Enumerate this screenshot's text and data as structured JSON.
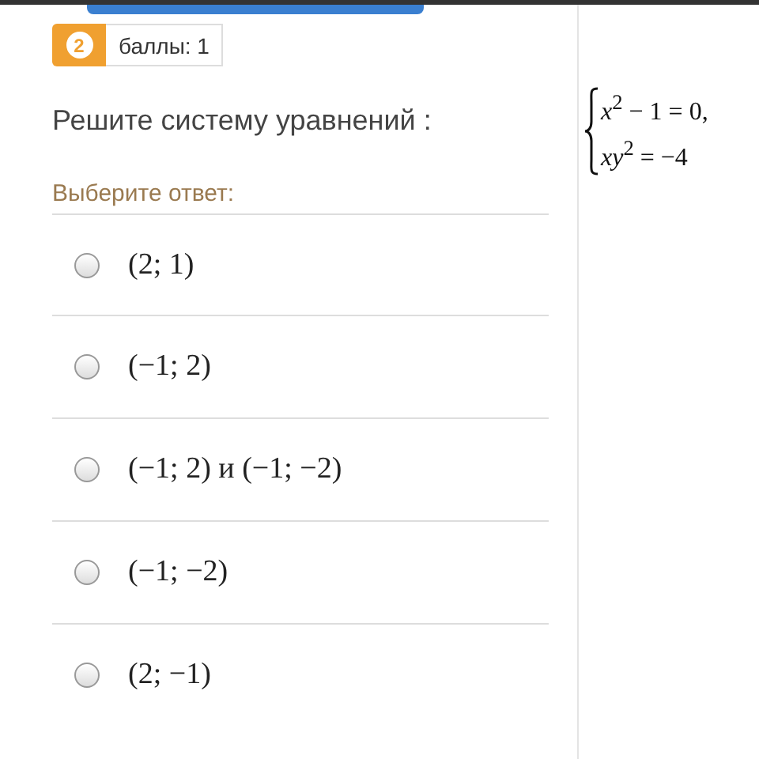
{
  "question_badge": {
    "number": "2",
    "points": "баллы: 1"
  },
  "question": {
    "text": "Решите систему уравнений :",
    "system": [
      "*x*$^{2}$ − 1 = 0,",
      "*xy*$^{2}$ = −4"
    ]
  },
  "answer_prompt": "Выберите ответ:",
  "options": [
    {
      "label": "(2; 1)",
      "selected": false
    },
    {
      "label": "(−1; 2)",
      "selected": false
    },
    {
      "label": "(−1; 2) и (−1; −2)",
      "selected": false
    },
    {
      "label": "(−1; −2)",
      "selected": false
    },
    {
      "label": "(2; −1)",
      "selected": false
    }
  ]
}
